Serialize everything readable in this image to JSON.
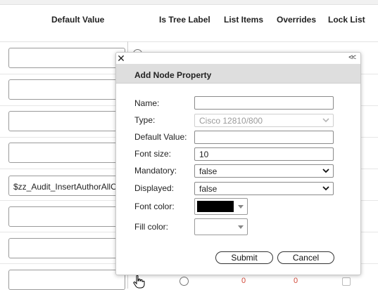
{
  "table": {
    "columns": [
      "Default Value",
      "Is Tree Label",
      "List Items",
      "Overrides",
      "Lock List"
    ],
    "rows": [
      {
        "default_value": ""
      },
      {
        "default_value": ""
      },
      {
        "default_value": ""
      },
      {
        "default_value": ""
      },
      {
        "default_value": "$zz_Audit_InsertAuthorAllOb"
      },
      {
        "default_value": ""
      },
      {
        "default_value": ""
      },
      {
        "default_value": "",
        "list_items": "0",
        "overrides": "0"
      }
    ]
  },
  "dialog": {
    "close_glyph": "✕",
    "collapse_glyph": "<<",
    "title": "Add Node Property",
    "fields": {
      "name": {
        "label": "Name:",
        "value": ""
      },
      "type": {
        "label": "Type:",
        "value": "Cisco 12810/800"
      },
      "default_value": {
        "label": "Default Value:",
        "value": ""
      },
      "font_size": {
        "label": "Font size:",
        "value": "10"
      },
      "mandatory": {
        "label": "Mandatory:",
        "value": "false"
      },
      "displayed": {
        "label": "Displayed:",
        "value": "false"
      },
      "font_color": {
        "label": "Font color:",
        "color": "#000000"
      },
      "fill_color": {
        "label": "Fill color:",
        "color": ""
      }
    },
    "submit_label": "Submit",
    "cancel_label": "Cancel"
  },
  "icons": {
    "close": "close-icon",
    "collapse": "collapse-icon",
    "dropdown": "chevron-down-icon",
    "cursor": "hand-cursor-icon"
  }
}
